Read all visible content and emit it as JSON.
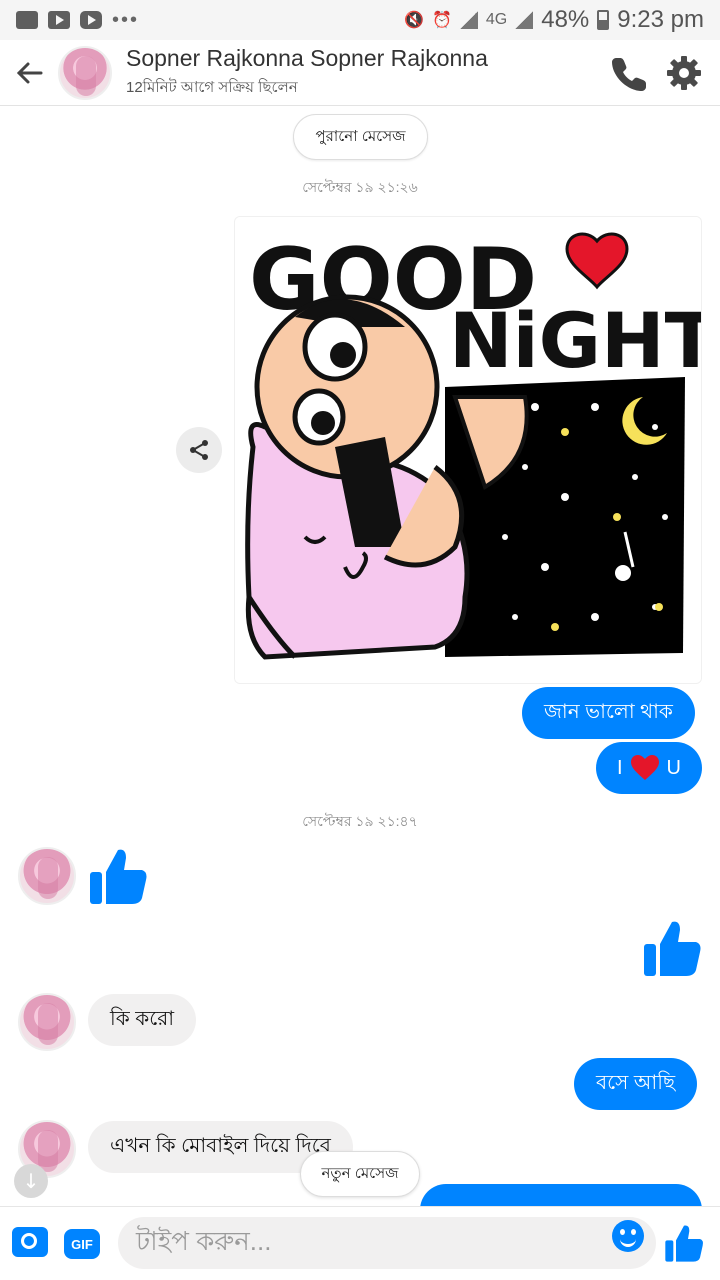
{
  "status_bar": {
    "battery": "48%",
    "time": "9:23 pm",
    "network": "4G"
  },
  "header": {
    "contact_name": "Sopner Rajkonna Sopner Rajkonna",
    "status": "12মিনিট আগে সক্রিয় ছিলেন"
  },
  "chat": {
    "older_messages_label": "পুরানো মেসেজ",
    "timestamp_1": "সেপ্টেম্বর ১৯ ২১:২৬",
    "sticker": {
      "line1": "GOOD",
      "line2": "NiGHT"
    },
    "outgoing_1": "জান ভালো থাক",
    "outgoing_2_left": "I",
    "outgoing_2_right": "U",
    "timestamp_2": "সেপ্টেম্বর ১৯ ২১:৪৭",
    "incoming_1": "কি করো",
    "outgoing_3": "বসে আছি",
    "incoming_2": "এখন কি মোবাইল দিয়ে  দিবে",
    "new_message_label": "নতুন মেসেজ"
  },
  "composer": {
    "gif_label": "GIF",
    "placeholder": "টাইপ করুন..."
  },
  "colors": {
    "accent": "#0084ff",
    "incoming_bubble": "#f1f0f0",
    "heart": "#e4162a"
  }
}
